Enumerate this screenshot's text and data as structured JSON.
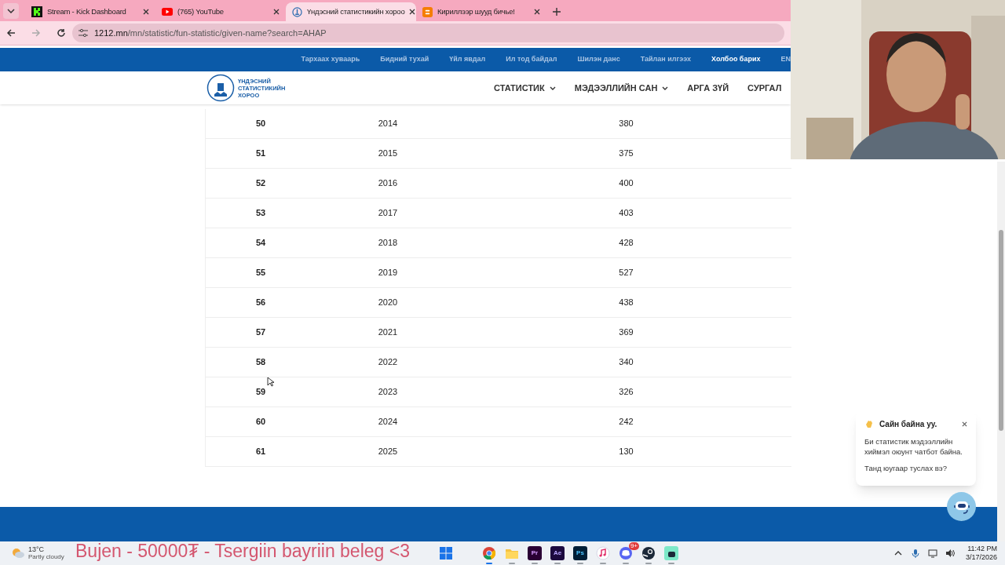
{
  "browser": {
    "tabs": [
      {
        "title": "Stream - Kick Dashboard",
        "kind": "kick",
        "selected": false
      },
      {
        "title": "(765) YouTube",
        "kind": "youtube",
        "selected": false
      },
      {
        "title": "Үндэсний статистикийн хороо",
        "kind": "nso",
        "selected": true
      },
      {
        "title": "Кириллээр шууд бичье!",
        "kind": "blogger",
        "selected": false
      }
    ],
    "url_host": "1212.mn",
    "url_path": "/mn/statistic/fun-statistic/given-name?search=АНАР"
  },
  "top_links": [
    {
      "label": "Тархаах хуваарь",
      "selected": false
    },
    {
      "label": "Бидний тухай",
      "selected": false
    },
    {
      "label": "Үйл явдал",
      "selected": false
    },
    {
      "label": "Ил тод байдал",
      "selected": false
    },
    {
      "label": "Шилэн данс",
      "selected": false
    },
    {
      "label": "Тайлан илгээх",
      "selected": false
    },
    {
      "label": "Холбоо барих",
      "selected": true
    },
    {
      "label": "EN",
      "selected": false
    }
  ],
  "logo_text": [
    "ҮНДЭСНИЙ",
    "СТАТИСТИКИЙН",
    "ХОРОО"
  ],
  "nav": [
    {
      "label": "СТАТИСТИК",
      "dropdown": true
    },
    {
      "label": "МЭДЭЭЛЛИЙН САН",
      "dropdown": true
    },
    {
      "label": "АРГА ЗҮЙ",
      "dropdown": false
    },
    {
      "label": "СУРГАЛ",
      "dropdown": false
    }
  ],
  "table": {
    "rows": [
      [
        "50",
        "2014",
        "380"
      ],
      [
        "51",
        "2015",
        "375"
      ],
      [
        "52",
        "2016",
        "400"
      ],
      [
        "53",
        "2017",
        "403"
      ],
      [
        "54",
        "2018",
        "428"
      ],
      [
        "55",
        "2019",
        "527"
      ],
      [
        "56",
        "2020",
        "438"
      ],
      [
        "57",
        "2021",
        "369"
      ],
      [
        "58",
        "2022",
        "340"
      ],
      [
        "59",
        "2023",
        "326"
      ],
      [
        "60",
        "2024",
        "242"
      ],
      [
        "61",
        "2025",
        "130"
      ]
    ]
  },
  "chat_popup": {
    "greeting": "Сайн байна уу.",
    "message": "Би статистик мэдээллийн хиймэл оюунт чатбот байна.",
    "question": "Танд юугаар туслах вэ?"
  },
  "stream_alert": "Bujen - 50000₮ - Tsergiin bayriin beleg <3",
  "taskbar": {
    "weather_temp": "13°C",
    "weather_text": "Partly cloudy",
    "apps": [
      {
        "kind": "chrome",
        "active": true
      },
      {
        "kind": "folder",
        "active": false
      },
      {
        "kind": "pr",
        "label": "Pr",
        "active": false
      },
      {
        "kind": "ae",
        "label": "Ae",
        "active": false
      },
      {
        "kind": "ps",
        "label": "Ps",
        "active": false
      },
      {
        "kind": "music",
        "active": false
      },
      {
        "kind": "discord",
        "badge": "9+",
        "active": false
      },
      {
        "kind": "steam",
        "active": false
      },
      {
        "kind": "bot",
        "active": false
      }
    ],
    "time": "11:42 PM",
    "date": "3/17/2026"
  }
}
